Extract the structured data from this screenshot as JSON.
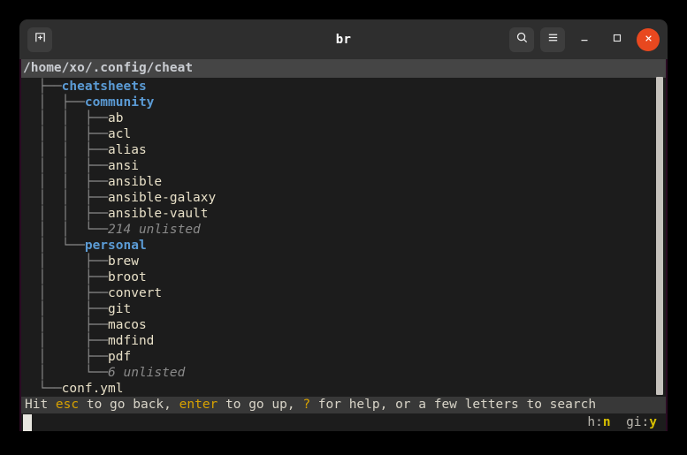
{
  "titlebar": {
    "new_tab_icon": "new-tab-icon",
    "title": "br",
    "search_icon": "search-icon",
    "menu_icon": "hamburger-menu-icon",
    "minimize_icon": "minimize-icon",
    "maximize_icon": "maximize-icon",
    "close_icon": "close-icon"
  },
  "path": "/home/xo/.config/cheat",
  "tree": [
    {
      "branch": "  ├──",
      "label": "cheatsheets",
      "kind": "dir"
    },
    {
      "branch": "  │  ├──",
      "label": "community",
      "kind": "dir"
    },
    {
      "branch": "  │  │  ├──",
      "label": "ab",
      "kind": "file"
    },
    {
      "branch": "  │  │  ├──",
      "label": "acl",
      "kind": "file"
    },
    {
      "branch": "  │  │  ├──",
      "label": "alias",
      "kind": "file"
    },
    {
      "branch": "  │  │  ├──",
      "label": "ansi",
      "kind": "file"
    },
    {
      "branch": "  │  │  ├──",
      "label": "ansible",
      "kind": "file"
    },
    {
      "branch": "  │  │  ├──",
      "label": "ansible-galaxy",
      "kind": "file"
    },
    {
      "branch": "  │  │  ├──",
      "label": "ansible-vault",
      "kind": "file"
    },
    {
      "branch": "  │  │  └──",
      "label": "214 unlisted",
      "kind": "unlisted"
    },
    {
      "branch": "  │  └──",
      "label": "personal",
      "kind": "dir"
    },
    {
      "branch": "  │     ├──",
      "label": "brew",
      "kind": "file"
    },
    {
      "branch": "  │     ├──",
      "label": "broot",
      "kind": "file"
    },
    {
      "branch": "  │     ├──",
      "label": "convert",
      "kind": "file"
    },
    {
      "branch": "  │     ├──",
      "label": "git",
      "kind": "file"
    },
    {
      "branch": "  │     ├──",
      "label": "macos",
      "kind": "file"
    },
    {
      "branch": "  │     ├──",
      "label": "mdfind",
      "kind": "file"
    },
    {
      "branch": "  │     ├──",
      "label": "pdf",
      "kind": "file"
    },
    {
      "branch": "  │     └──",
      "label": "6 unlisted",
      "kind": "unlisted"
    },
    {
      "branch": "  └──",
      "label": "conf.yml",
      "kind": "file"
    }
  ],
  "statusbar": {
    "seg1": "Hit ",
    "key1": "esc",
    "seg2": " to go back, ",
    "key2": "enter",
    "seg3": " to go up, ",
    "key3": "?",
    "seg4": " for help, or a few letters to search"
  },
  "hints": {
    "hint1_label": "h:",
    "hint1_key": "n",
    "hint2_label": "gi:",
    "hint2_key": "y"
  },
  "colors": {
    "accent_close": "#e8481f",
    "dir": "#5b9bd5",
    "file": "#e8e0c8",
    "key": "#d8a200",
    "pathbar_bg": "#454545"
  }
}
